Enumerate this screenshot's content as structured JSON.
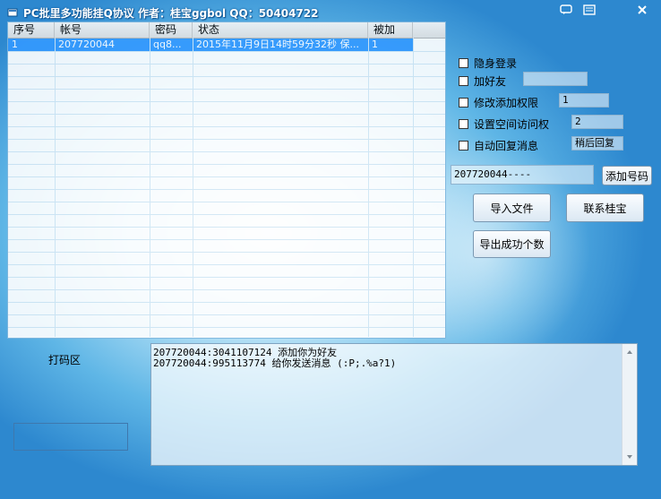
{
  "window": {
    "title": "PC批里多功能挂Q协议   作者：桂宝ggbol QQ：50404722",
    "controls": {
      "skin_icon": "skin-icon",
      "menu_icon": "menu-icon",
      "close_icon": "close-icon"
    }
  },
  "list": {
    "columns": [
      "序号",
      "帐号",
      "密码",
      "状态",
      "被加"
    ],
    "rows": [
      {
        "index": "1",
        "account": "207720044",
        "password": "qq8...",
        "status": "2015年11月9日14时59分32秒 保...",
        "added": "1"
      }
    ]
  },
  "options": {
    "stealth_login": "隐身登录",
    "add_friend": "加好友",
    "add_friend_value": "",
    "modify_permission": "修改添加权限",
    "modify_permission_value": "1",
    "space_access": "设置空间访问权",
    "space_access_value": "2",
    "auto_reply": "自动回复消息",
    "auto_reply_value": "稍后回复"
  },
  "account_input": {
    "value": "207720044----"
  },
  "buttons": {
    "add_number": "添加号码",
    "import_file": "导入文件",
    "contact": "联系桂宝",
    "export_success": "导出成功个数"
  },
  "captcha": {
    "label": "打码区"
  },
  "log": {
    "lines": [
      "207720044:3041107124 添加你为好友",
      "207720044:995113774 给你发送消息 (:P;.%a?1)"
    ]
  },
  "colors": {
    "selection": "#3399ff",
    "background": "#5fb6e6"
  }
}
